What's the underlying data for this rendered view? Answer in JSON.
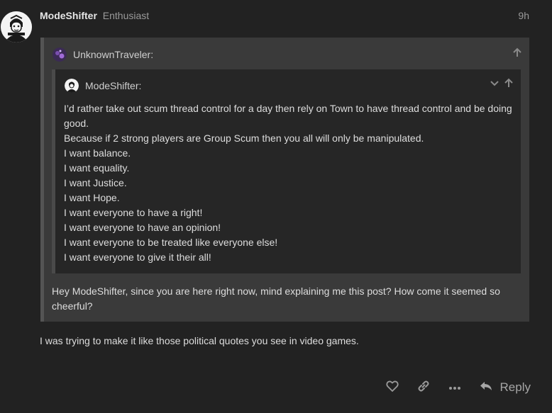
{
  "post": {
    "username": "ModeShifter",
    "user_title": "Enthusiast",
    "date": "9h",
    "reply_text": "I was trying to make it like those political quotes you see in video games."
  },
  "outer_quote": {
    "author": "UnknownTraveler:",
    "body": "Hey ModeShifter, since you are here right now, mind explaining me this post? How come it seemed so cheerful?"
  },
  "inner_quote": {
    "author": "ModeShifter:",
    "lines": [
      "I’d rather take out scum thread control for a day then rely on Town to have thread control and be doing good.",
      "Because if 2 strong players are Group Scum then you all will only be manipulated.",
      "I want balance.",
      "I want equality.",
      "I want Justice.",
      "I want Hope.",
      "I want everyone to have a right!",
      "I want everyone to have an opinion!",
      "I want everyone to be treated like everyone else!",
      "I want everyone to give it their all!"
    ]
  },
  "actions": {
    "reply_label": "Reply"
  },
  "colors": {
    "background": "#222222",
    "quote_outer": "#3a3a3a",
    "quote_inner": "#262626",
    "muted_text": "#9a9a9a"
  },
  "icons": [
    "avatar-warrior",
    "heart-icon",
    "link-icon",
    "more-icon",
    "reply-icon",
    "arrow-up-icon",
    "chevron-down-icon"
  ]
}
